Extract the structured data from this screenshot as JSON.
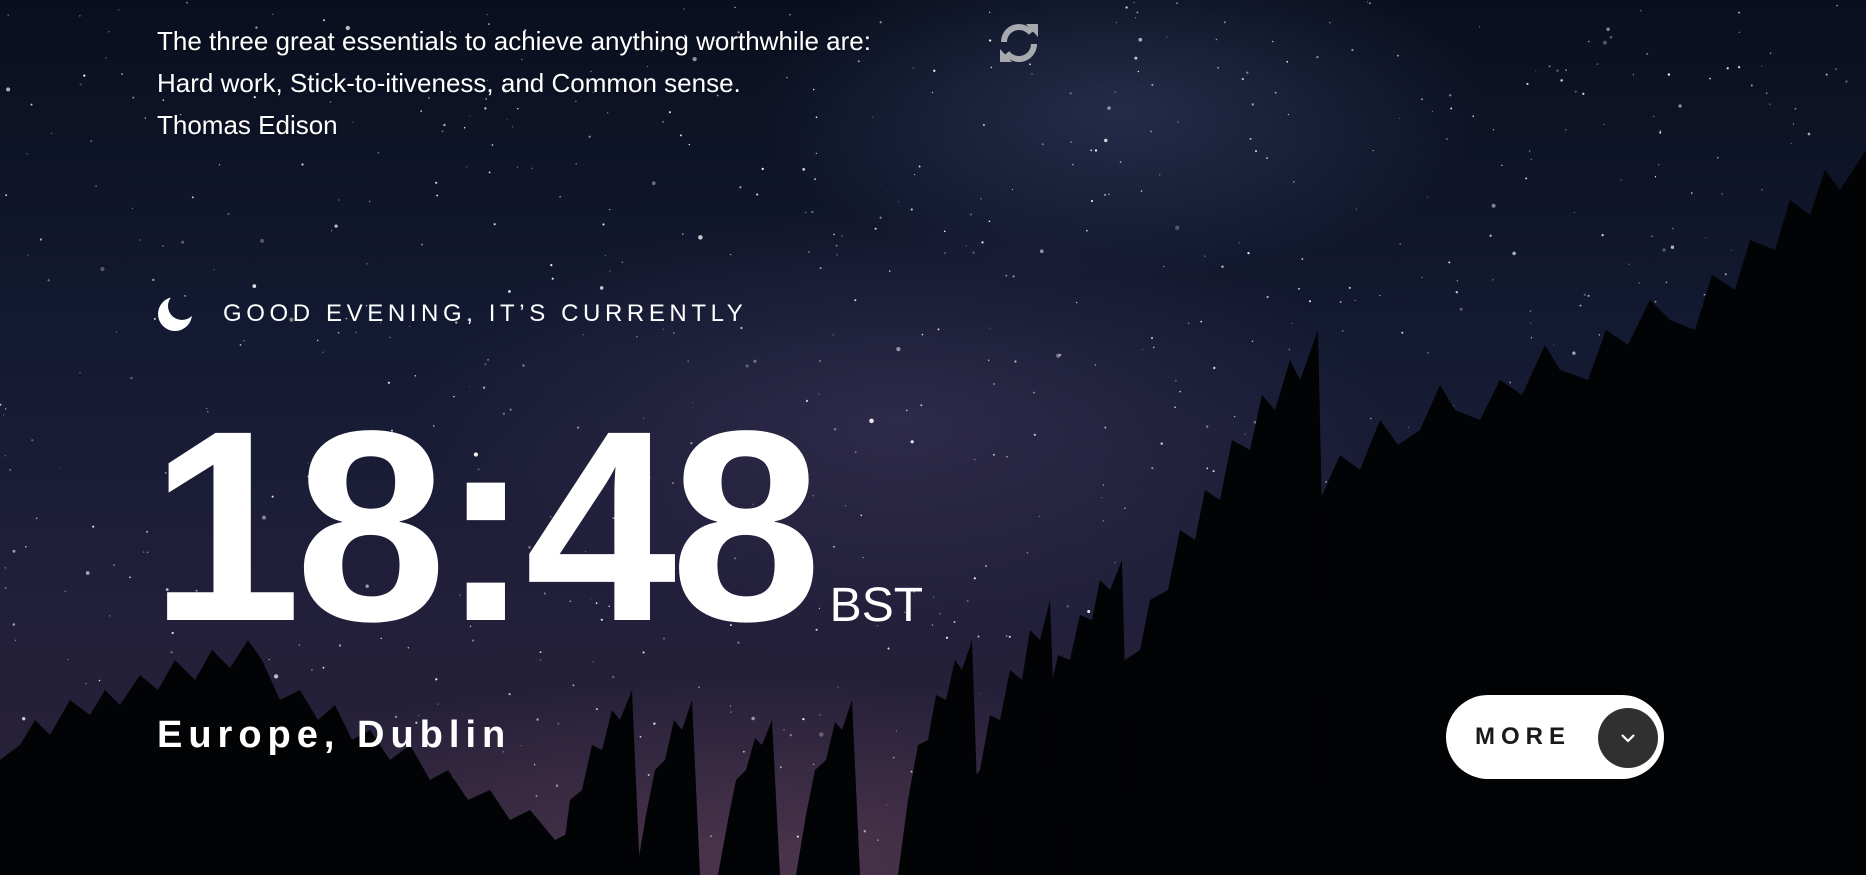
{
  "quote": {
    "lines": [
      "The three great essentials to achieve anything worthwhile are:",
      "Hard work, Stick-to-itiveness, and Common sense."
    ],
    "author": "Thomas Edison"
  },
  "refresh_icon": "refresh-icon",
  "greeting": {
    "icon": "moon-icon",
    "text": "GOOD EVENING, IT’S CURRENTLY"
  },
  "clock": {
    "time": "18:48",
    "zone": "BST"
  },
  "location": "Europe, Dublin",
  "more_button": {
    "label": "MORE",
    "icon": "chevron-down-icon"
  }
}
